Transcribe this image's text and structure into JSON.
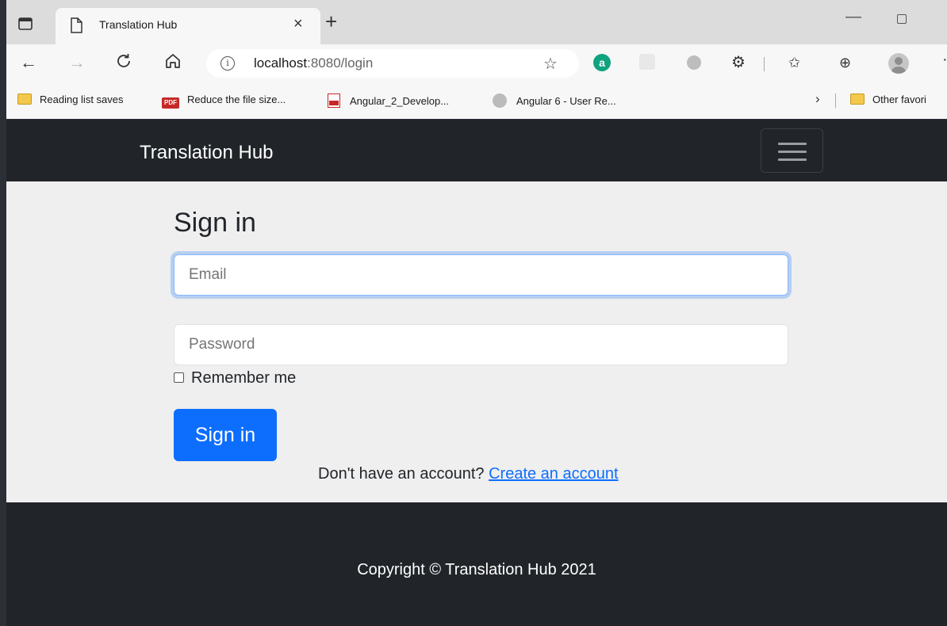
{
  "browser": {
    "tab_title": "Translation Hub",
    "tab_close": "×",
    "new_tab": "+",
    "url_host": "localhost",
    "url_rest": ":8080/login",
    "bookmarks": [
      {
        "label": "Reading list saves",
        "icon": "folder-icon"
      },
      {
        "label": "Reduce the file size...",
        "icon": "pdf-icon"
      },
      {
        "label": "Angular_2_Develop...",
        "icon": "pdf-icon"
      },
      {
        "label": "Angular 6 - User Re...",
        "icon": "person-icon"
      }
    ],
    "other_favorites": "Other favori",
    "ext_a_letter": "a"
  },
  "navbar": {
    "brand": "Translation Hub"
  },
  "form": {
    "title": "Sign in",
    "email_placeholder": "Email",
    "password_placeholder": "Password",
    "remember_label": "Remember me",
    "submit_label": "Sign in",
    "account_prompt": "Don't have an account?",
    "create_link": "Create an account"
  },
  "footer": {
    "copyright": "Copyright © Translation Hub 2021"
  },
  "colors": {
    "primary": "#0d6efd",
    "dark": "#212529",
    "page_bg": "#efefef"
  }
}
